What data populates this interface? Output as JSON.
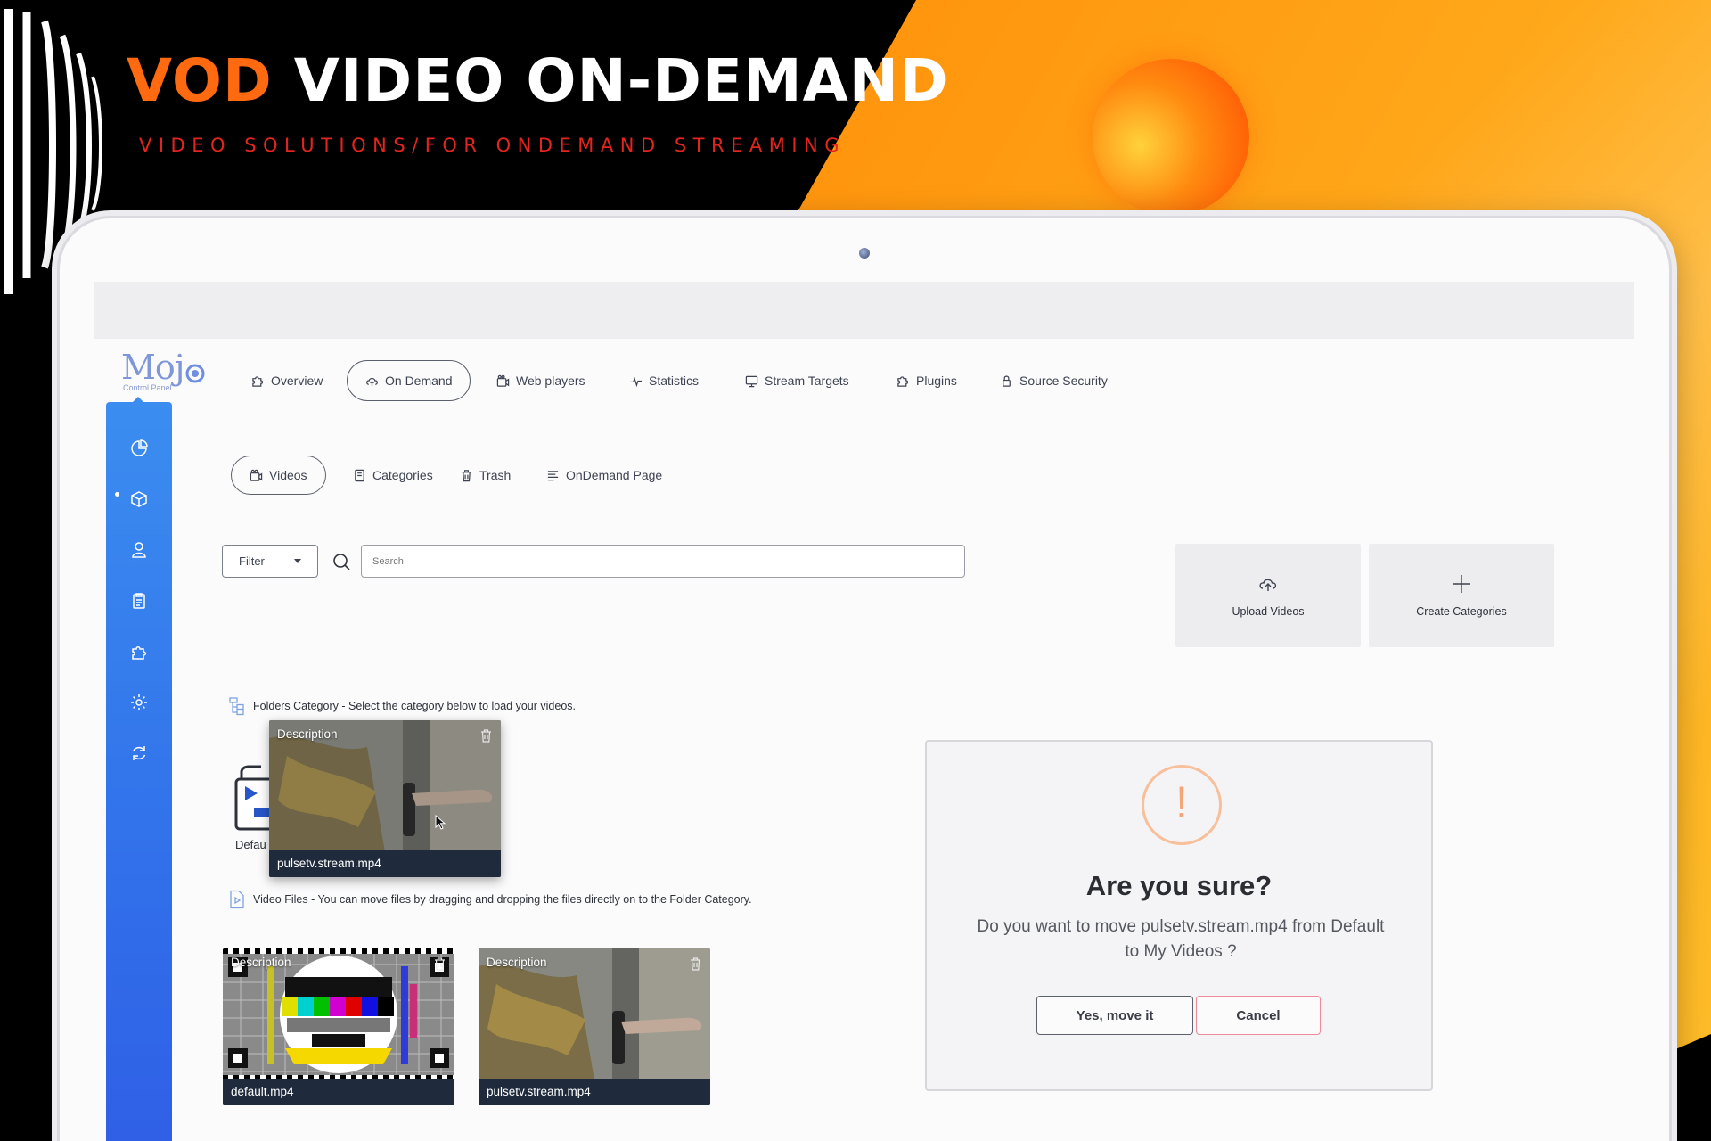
{
  "banner": {
    "headline_accent": "VOD",
    "headline_rest": " VIDEO ON-DEMAND",
    "subline": "VIDEO SOLUTIONS/FOR ONDEMAND STREAMING",
    "accent_color": "#ff6a10",
    "subline_color": "#e4241f"
  },
  "app": {
    "logo": "Moj",
    "logo_sub": "Control Panel"
  },
  "sidebar": {
    "items": [
      {
        "icon": "pie-chart-icon"
      },
      {
        "icon": "cube-icon",
        "active": true
      },
      {
        "icon": "user-icon"
      },
      {
        "icon": "clipboard-icon"
      },
      {
        "icon": "puzzle-icon"
      },
      {
        "icon": "gear-icon"
      },
      {
        "icon": "refresh-icon"
      }
    ],
    "color": "#3170ea"
  },
  "nav": {
    "items": [
      {
        "label": "Overview",
        "icon": "puzzle-icon"
      },
      {
        "label": "On Demand",
        "icon": "cloud-upload-icon",
        "active": true
      },
      {
        "label": "Web players",
        "icon": "video-icon"
      },
      {
        "label": "Statistics",
        "icon": "pulse-icon"
      },
      {
        "label": "Stream Targets",
        "icon": "monitor-icon"
      },
      {
        "label": "Plugins",
        "icon": "puzzle-icon"
      },
      {
        "label": "Source Security",
        "icon": "lock-icon"
      }
    ]
  },
  "subnav": {
    "items": [
      {
        "label": "Videos",
        "icon": "video-icon",
        "active": true
      },
      {
        "label": "Categories",
        "icon": "book-icon"
      },
      {
        "label": "Trash",
        "icon": "trash-icon"
      },
      {
        "label": "OnDemand Page",
        "icon": "list-icon"
      }
    ]
  },
  "toolbar": {
    "filter_label": "Filter",
    "search_placeholder": "Search"
  },
  "actions": {
    "upload_label": "Upload Videos",
    "create_label": "Create Categories"
  },
  "folders": {
    "hint": "Folders Category - Select the category below to load your videos.",
    "default_label": "Defau",
    "dragging": {
      "desc": "Description",
      "caption": "pulsetv.stream.mp4"
    }
  },
  "files": {
    "hint": "Video Files - You can move files by dragging and dropping the files directly on to the Folder Category.",
    "items": [
      {
        "desc": "Description",
        "caption": "default.mp4"
      },
      {
        "desc": "Description",
        "caption": "pulsetv.stream.mp4"
      }
    ]
  },
  "modal": {
    "icon_glyph": "!",
    "title": "Are you sure?",
    "text": "Do you want to move pulsetv.stream.mp4 from Default to My Videos ?",
    "confirm_label": "Yes, move it",
    "cancel_label": "Cancel"
  }
}
